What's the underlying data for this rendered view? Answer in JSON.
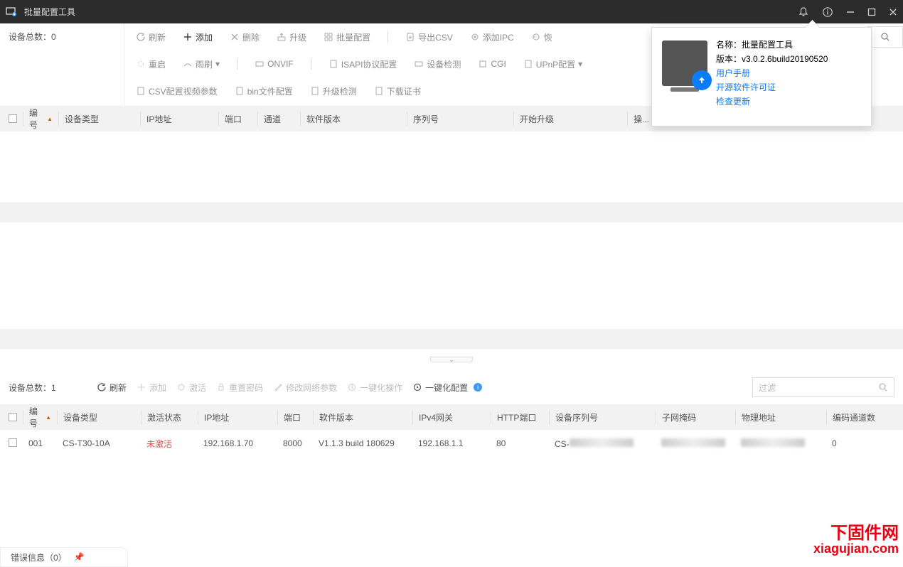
{
  "app": {
    "title": "批量配置工具"
  },
  "top": {
    "deviceCountLabel": "设备总数：0",
    "toolbar1": {
      "refresh": "刷新",
      "add": "添加",
      "delete": "删除",
      "upgrade": "升级",
      "batchConfig": "批量配置",
      "exportCsv": "导出CSV",
      "addIpc": "添加IPC",
      "restore": "恢"
    },
    "toolbar2": {
      "reboot": "重启",
      "wiper": "雨刷",
      "onvif": "ONVIF",
      "isapi": "ISAPI协议配置",
      "detect": "设备检测",
      "cgi": "CGI",
      "upnp": "UPnP配置"
    },
    "toolbar3": {
      "csvVideo": "CSV配置视频参数",
      "binConfig": "bin文件配置",
      "upgradeCheck": "升级检测",
      "downloadCert": "下载证书"
    }
  },
  "table1": {
    "headers": {
      "id": "编号",
      "type": "设备类型",
      "ip": "IP地址",
      "port": "端口",
      "channel": "通道",
      "version": "软件版本",
      "serial": "序列号",
      "startUpgrade": "开始升级",
      "op": "操..."
    }
  },
  "panel2": {
    "deviceCountLabel": "设备总数：1",
    "buttons": {
      "refresh": "刷新",
      "add": "添加",
      "activate": "激活",
      "resetPwd": "重置密码",
      "modifyNet": "修改网络参数",
      "oneClickOp": "一键化操作",
      "oneClickCfg": "一键化配置"
    },
    "filterPlaceholder": "过滤"
  },
  "table2": {
    "headers": {
      "id": "编号",
      "type": "设备类型",
      "status": "激活状态",
      "ip": "IP地址",
      "port": "端口",
      "version": "软件版本",
      "gateway": "IPv4网关",
      "httpPort": "HTTP端口",
      "serial": "设备序列号",
      "subnet": "子网掩码",
      "mac": "物理地址",
      "encodeCh": "编码通道数"
    },
    "row": {
      "id": "001",
      "type": "CS-T30-10A",
      "status": "未激活",
      "ip": "192.168.1.70",
      "port": "8000",
      "version": "V1.1.3 build 180629",
      "gateway": "192.168.1.1",
      "httpPort": "80",
      "serialPrefix": "CS-",
      "encodeCh": "0"
    }
  },
  "popover": {
    "nameLabel": "名称：",
    "nameValue": "批量配置工具",
    "versionLabel": "版本：",
    "versionValue": "v3.0.2.6build20190520",
    "links": {
      "manual": "用户手册",
      "license": "开源软件许可证",
      "check": "检查更新"
    }
  },
  "status": {
    "errorInfo": "错误信息（0）"
  },
  "watermark": {
    "line1": "下固件网",
    "line2": "xiagujian.com"
  }
}
